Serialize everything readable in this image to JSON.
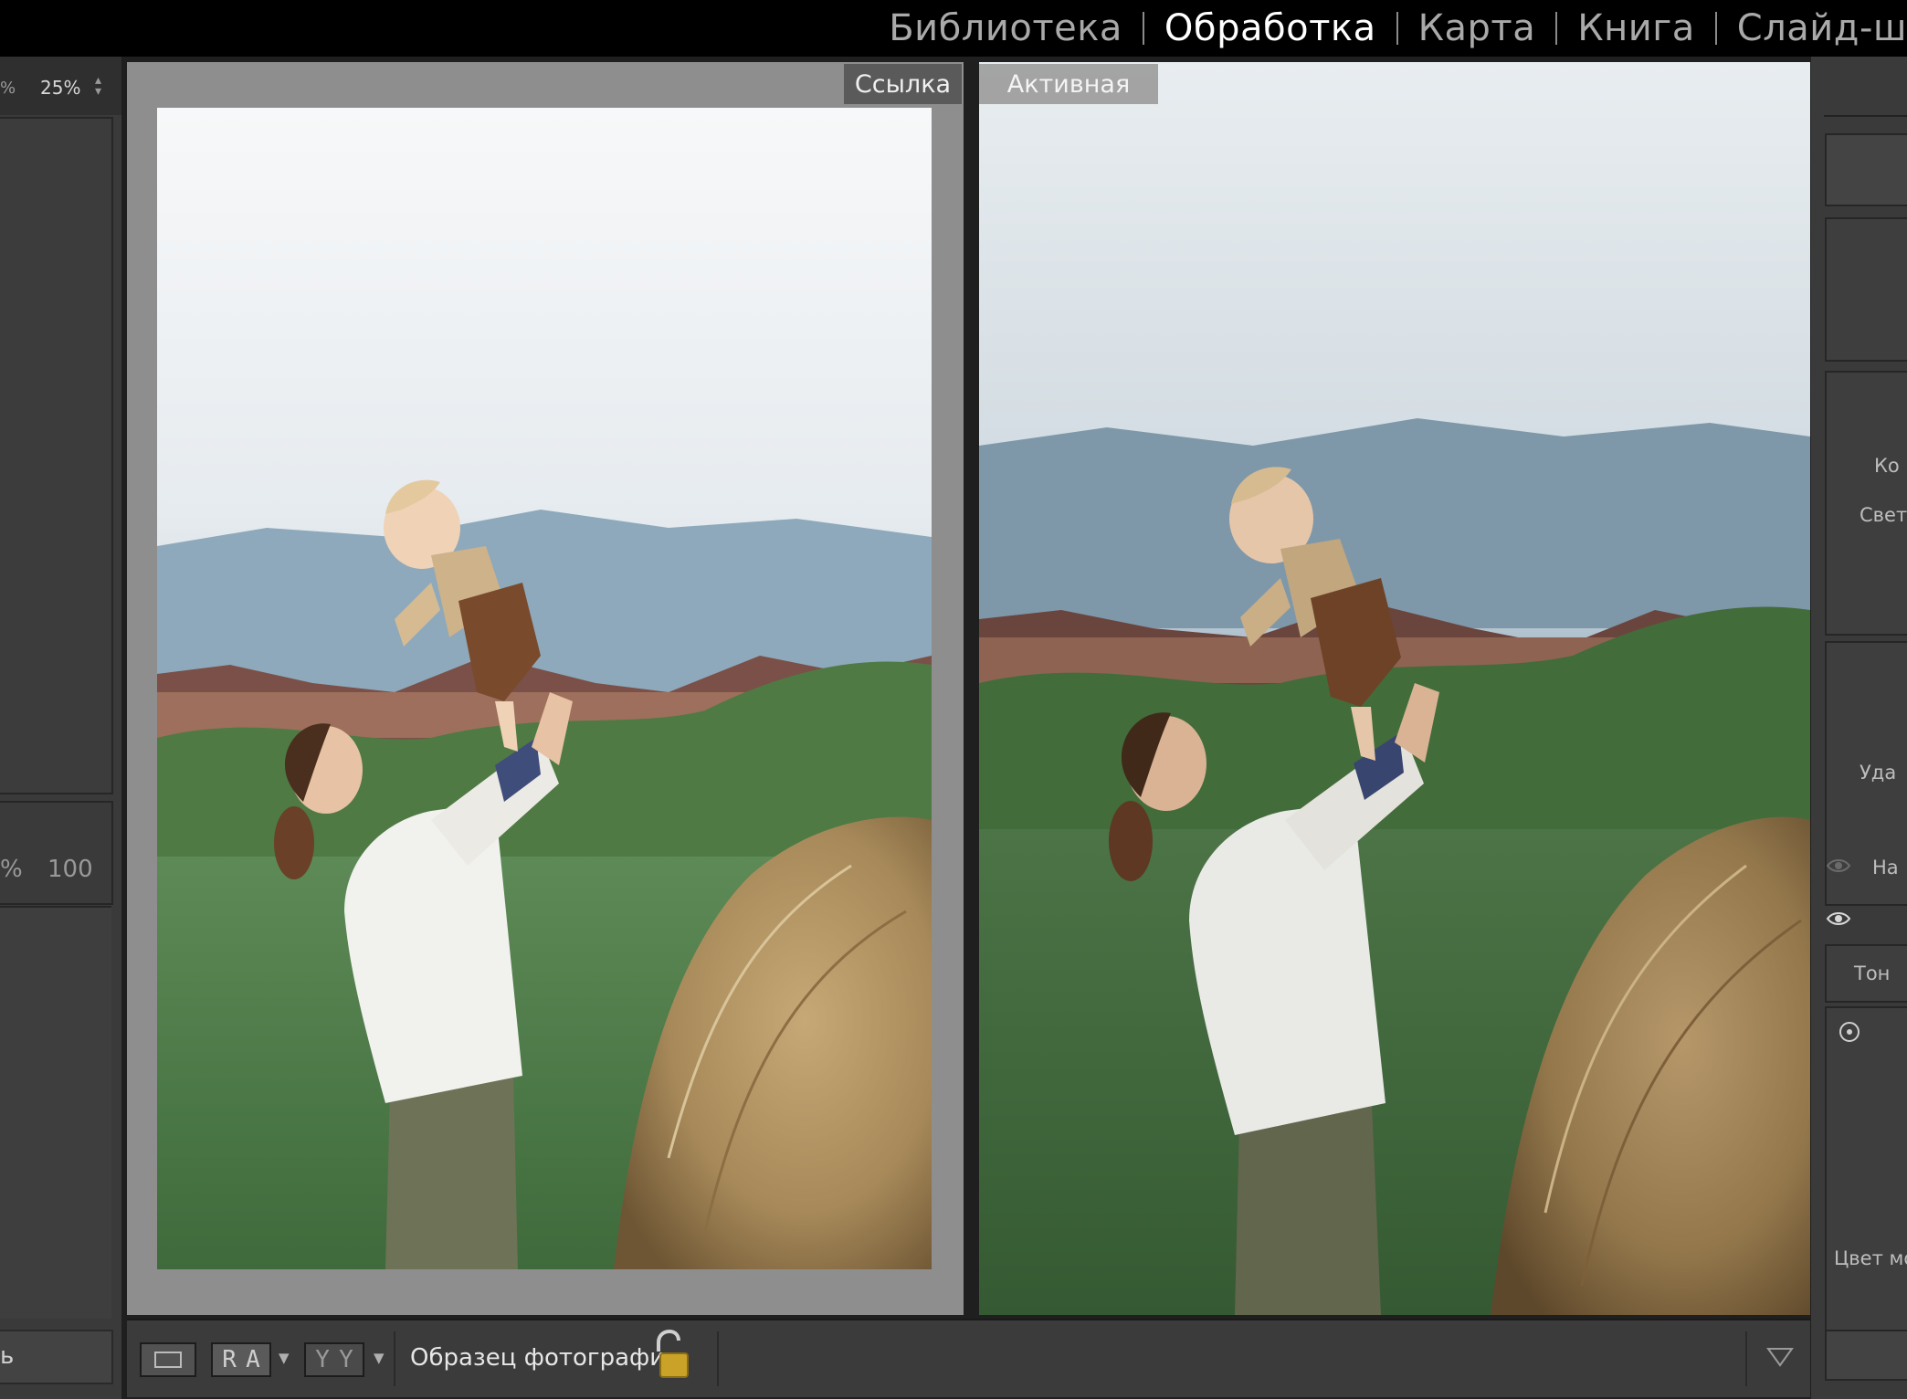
{
  "modules": {
    "library": "Библиотека",
    "develop": "Обработка",
    "map": "Карта",
    "book": "Книга",
    "slideshow": "Слайд-ш"
  },
  "left_panel": {
    "zoom_prefix": "%",
    "zoom_value": "25%",
    "strength_value": "100",
    "strength_prefix": "%",
    "bottom_button": "ь"
  },
  "view": {
    "reference_label": "Ссылка",
    "active_label": "Активная"
  },
  "toolbar": {
    "ra_letters": [
      "R",
      "A"
    ],
    "yy_letters": [
      "Y",
      "Y"
    ],
    "sample_photo_label": "Образец фотографии:"
  },
  "right_panel": {
    "labels": [
      "Ко",
      "Свет",
      "Уда",
      "На",
      "Тон",
      "Цвет мо"
    ]
  },
  "colors": {
    "lock_icon": "#c9a227",
    "module_active": "#ffffff",
    "module_inactive": "#a9a9a9"
  }
}
